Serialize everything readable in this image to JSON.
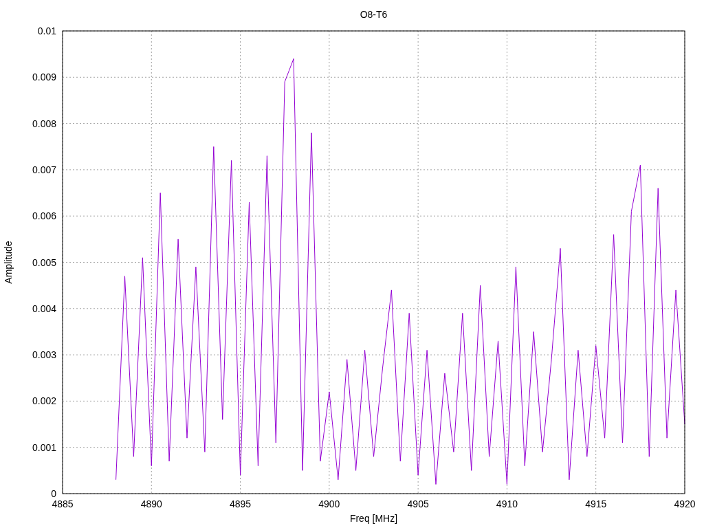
{
  "plot": {
    "chart_data": {
      "type": "line",
      "title": "O8-T6",
      "xlabel": "Freq [MHz]",
      "ylabel": "Amplitude",
      "xlim": [
        4885,
        4920
      ],
      "ylim": [
        0,
        0.01
      ],
      "xticks": [
        4885,
        4890,
        4895,
        4900,
        4905,
        4910,
        4915,
        4920
      ],
      "yticks": [
        {
          "value": 0,
          "label": "0"
        },
        {
          "value": 0.001,
          "label": "0.001"
        },
        {
          "value": 0.002,
          "label": "0.002"
        },
        {
          "value": 0.003,
          "label": "0.003"
        },
        {
          "value": 0.004,
          "label": "0.004"
        },
        {
          "value": 0.005,
          "label": "0.005"
        },
        {
          "value": 0.006,
          "label": "0.006"
        },
        {
          "value": 0.007,
          "label": "0.007"
        },
        {
          "value": 0.008,
          "label": "0.008"
        },
        {
          "value": 0.009,
          "label": "0.009"
        },
        {
          "value": 0.01,
          "label": "0.01"
        }
      ],
      "x": [
        4888,
        4888.5,
        4889,
        4889.5,
        4890,
        4890.5,
        4891,
        4891.5,
        4892,
        4892.5,
        4893,
        4893.5,
        4894,
        4894.5,
        4895,
        4895.5,
        4896,
        4896.5,
        4897,
        4897.5,
        4898,
        4898.5,
        4899,
        4899.5,
        4900,
        4900.5,
        4901,
        4901.5,
        4902,
        4902.5,
        4903,
        4903.5,
        4904,
        4904.5,
        4905,
        4905.5,
        4906,
        4906.5,
        4907,
        4907.5,
        4908,
        4908.5,
        4909,
        4909.5,
        4910,
        4910.5,
        4911,
        4911.5,
        4912,
        4912.5,
        4913,
        4913.5,
        4914,
        4914.5,
        4915,
        4915.5,
        4916,
        4916.5,
        4917,
        4917.5,
        4918,
        4918.5,
        4919,
        4919.5,
        4920
      ],
      "grid": true,
      "series": [
        {
          "color": "#9400d3",
          "values": [
            0.0003,
            0.0047,
            0.0008,
            0.0051,
            0.0006,
            0.0065,
            0.0007,
            0.0055,
            0.0012,
            0.0049,
            0.0009,
            0.0075,
            0.0016,
            0.0072,
            0.0004,
            0.0063,
            0.0006,
            0.0073,
            0.0011,
            0.0089,
            0.0094,
            0.0005,
            0.0078,
            0.0007,
            0.0022,
            0.0003,
            0.0029,
            0.0005,
            0.0031,
            0.0008,
            0.0027,
            0.0044,
            0.0007,
            0.0039,
            0.0004,
            0.0031,
            0.0002,
            0.0026,
            0.0009,
            0.0039,
            0.0005,
            0.0045,
            0.0008,
            0.0033,
            0.0002,
            0.0049,
            0.0006,
            0.0035,
            0.0009,
            0.0029,
            0.0053,
            0.0003,
            0.0031,
            0.0008,
            0.0032,
            0.0012,
            0.0056,
            0.0011,
            0.0061,
            0.0071,
            0.0008,
            0.0066,
            0.0012,
            0.0044,
            0.0015
          ]
        }
      ]
    }
  }
}
